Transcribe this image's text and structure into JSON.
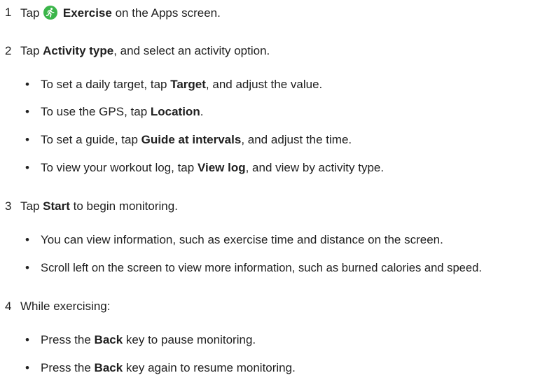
{
  "steps": [
    {
      "num": "1",
      "pre": "Tap",
      "icon": "running-person-icon",
      "bold": "Exercise",
      "post": " on the Apps screen."
    },
    {
      "num": "2",
      "pre": "Tap ",
      "bold": "Activity type",
      "post": ", and select an activity option.",
      "bullets": [
        {
          "pre": "To set a daily target, tap ",
          "bold": "Target",
          "post": ", and adjust the value."
        },
        {
          "pre": "To use the GPS, tap ",
          "bold": "Location",
          "post": "."
        },
        {
          "pre": "To set a guide, tap ",
          "bold": "Guide at intervals",
          "post": ", and adjust the time."
        },
        {
          "pre": "To view your workout log, tap ",
          "bold": "View log",
          "post": ", and view by activity type."
        }
      ]
    },
    {
      "num": "3",
      "pre": "Tap ",
      "bold": "Start",
      "post": " to begin monitoring.",
      "bullets": [
        {
          "text": "You can view information, such as exercise time and distance on the screen."
        },
        {
          "text": "Scroll left on the screen to view more information, such as burned calories and speed."
        }
      ]
    },
    {
      "num": "4",
      "text": "While exercising:",
      "bullets": [
        {
          "pre": "Press the ",
          "bold": "Back",
          "post": " key to pause monitoring."
        },
        {
          "pre": "Press the ",
          "bold": "Back",
          "post": " key again to resume monitoring."
        }
      ]
    }
  ],
  "bullet_char": "•",
  "colors": {
    "icon_bg": "#3bb54a",
    "text": "#1f1f1f"
  }
}
